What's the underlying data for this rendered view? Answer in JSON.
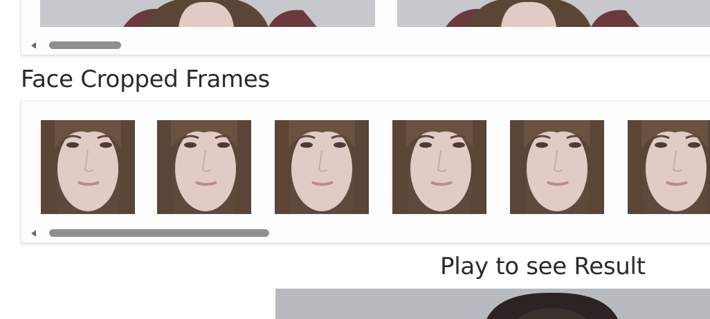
{
  "sections": {
    "face_cropped_title": "Face Cropped Frames",
    "result_title": "Play to see Result"
  },
  "face_frames": [
    {
      "name": "face-frame-1"
    },
    {
      "name": "face-frame-2"
    },
    {
      "name": "face-frame-3"
    },
    {
      "name": "face-frame-4"
    },
    {
      "name": "face-frame-5"
    },
    {
      "name": "face-frame-6"
    }
  ],
  "colors": {
    "panel_border": "#e6e6e6",
    "scroll_thumb": "#8f8f8f",
    "title_text": "#2a2a2a",
    "photo_background": "#c9cbce",
    "hair": "#5a4536",
    "skin": "#e2cbc4"
  }
}
